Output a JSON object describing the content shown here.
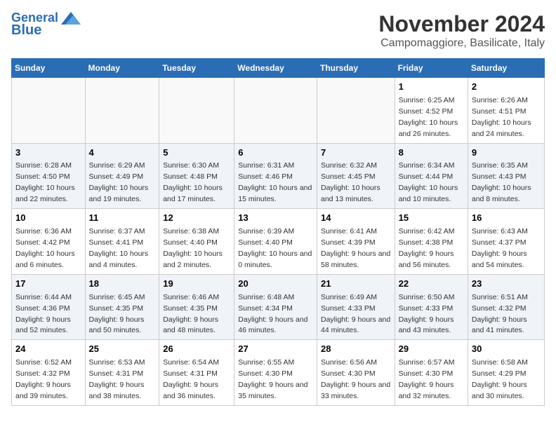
{
  "header": {
    "logo_line1": "General",
    "logo_line2": "Blue",
    "month": "November 2024",
    "location": "Campomaggiore, Basilicate, Italy"
  },
  "weekdays": [
    "Sunday",
    "Monday",
    "Tuesday",
    "Wednesday",
    "Thursday",
    "Friday",
    "Saturday"
  ],
  "weeks": [
    [
      {
        "day": "",
        "info": ""
      },
      {
        "day": "",
        "info": ""
      },
      {
        "day": "",
        "info": ""
      },
      {
        "day": "",
        "info": ""
      },
      {
        "day": "",
        "info": ""
      },
      {
        "day": "1",
        "info": "Sunrise: 6:25 AM\nSunset: 4:52 PM\nDaylight: 10 hours and 26 minutes."
      },
      {
        "day": "2",
        "info": "Sunrise: 6:26 AM\nSunset: 4:51 PM\nDaylight: 10 hours and 24 minutes."
      }
    ],
    [
      {
        "day": "3",
        "info": "Sunrise: 6:28 AM\nSunset: 4:50 PM\nDaylight: 10 hours and 22 minutes."
      },
      {
        "day": "4",
        "info": "Sunrise: 6:29 AM\nSunset: 4:49 PM\nDaylight: 10 hours and 19 minutes."
      },
      {
        "day": "5",
        "info": "Sunrise: 6:30 AM\nSunset: 4:48 PM\nDaylight: 10 hours and 17 minutes."
      },
      {
        "day": "6",
        "info": "Sunrise: 6:31 AM\nSunset: 4:46 PM\nDaylight: 10 hours and 15 minutes."
      },
      {
        "day": "7",
        "info": "Sunrise: 6:32 AM\nSunset: 4:45 PM\nDaylight: 10 hours and 13 minutes."
      },
      {
        "day": "8",
        "info": "Sunrise: 6:34 AM\nSunset: 4:44 PM\nDaylight: 10 hours and 10 minutes."
      },
      {
        "day": "9",
        "info": "Sunrise: 6:35 AM\nSunset: 4:43 PM\nDaylight: 10 hours and 8 minutes."
      }
    ],
    [
      {
        "day": "10",
        "info": "Sunrise: 6:36 AM\nSunset: 4:42 PM\nDaylight: 10 hours and 6 minutes."
      },
      {
        "day": "11",
        "info": "Sunrise: 6:37 AM\nSunset: 4:41 PM\nDaylight: 10 hours and 4 minutes."
      },
      {
        "day": "12",
        "info": "Sunrise: 6:38 AM\nSunset: 4:40 PM\nDaylight: 10 hours and 2 minutes."
      },
      {
        "day": "13",
        "info": "Sunrise: 6:39 AM\nSunset: 4:40 PM\nDaylight: 10 hours and 0 minutes."
      },
      {
        "day": "14",
        "info": "Sunrise: 6:41 AM\nSunset: 4:39 PM\nDaylight: 9 hours and 58 minutes."
      },
      {
        "day": "15",
        "info": "Sunrise: 6:42 AM\nSunset: 4:38 PM\nDaylight: 9 hours and 56 minutes."
      },
      {
        "day": "16",
        "info": "Sunrise: 6:43 AM\nSunset: 4:37 PM\nDaylight: 9 hours and 54 minutes."
      }
    ],
    [
      {
        "day": "17",
        "info": "Sunrise: 6:44 AM\nSunset: 4:36 PM\nDaylight: 9 hours and 52 minutes."
      },
      {
        "day": "18",
        "info": "Sunrise: 6:45 AM\nSunset: 4:35 PM\nDaylight: 9 hours and 50 minutes."
      },
      {
        "day": "19",
        "info": "Sunrise: 6:46 AM\nSunset: 4:35 PM\nDaylight: 9 hours and 48 minutes."
      },
      {
        "day": "20",
        "info": "Sunrise: 6:48 AM\nSunset: 4:34 PM\nDaylight: 9 hours and 46 minutes."
      },
      {
        "day": "21",
        "info": "Sunrise: 6:49 AM\nSunset: 4:33 PM\nDaylight: 9 hours and 44 minutes."
      },
      {
        "day": "22",
        "info": "Sunrise: 6:50 AM\nSunset: 4:33 PM\nDaylight: 9 hours and 43 minutes."
      },
      {
        "day": "23",
        "info": "Sunrise: 6:51 AM\nSunset: 4:32 PM\nDaylight: 9 hours and 41 minutes."
      }
    ],
    [
      {
        "day": "24",
        "info": "Sunrise: 6:52 AM\nSunset: 4:32 PM\nDaylight: 9 hours and 39 minutes."
      },
      {
        "day": "25",
        "info": "Sunrise: 6:53 AM\nSunset: 4:31 PM\nDaylight: 9 hours and 38 minutes."
      },
      {
        "day": "26",
        "info": "Sunrise: 6:54 AM\nSunset: 4:31 PM\nDaylight: 9 hours and 36 minutes."
      },
      {
        "day": "27",
        "info": "Sunrise: 6:55 AM\nSunset: 4:30 PM\nDaylight: 9 hours and 35 minutes."
      },
      {
        "day": "28",
        "info": "Sunrise: 6:56 AM\nSunset: 4:30 PM\nDaylight: 9 hours and 33 minutes."
      },
      {
        "day": "29",
        "info": "Sunrise: 6:57 AM\nSunset: 4:30 PM\nDaylight: 9 hours and 32 minutes."
      },
      {
        "day": "30",
        "info": "Sunrise: 6:58 AM\nSunset: 4:29 PM\nDaylight: 9 hours and 30 minutes."
      }
    ]
  ]
}
